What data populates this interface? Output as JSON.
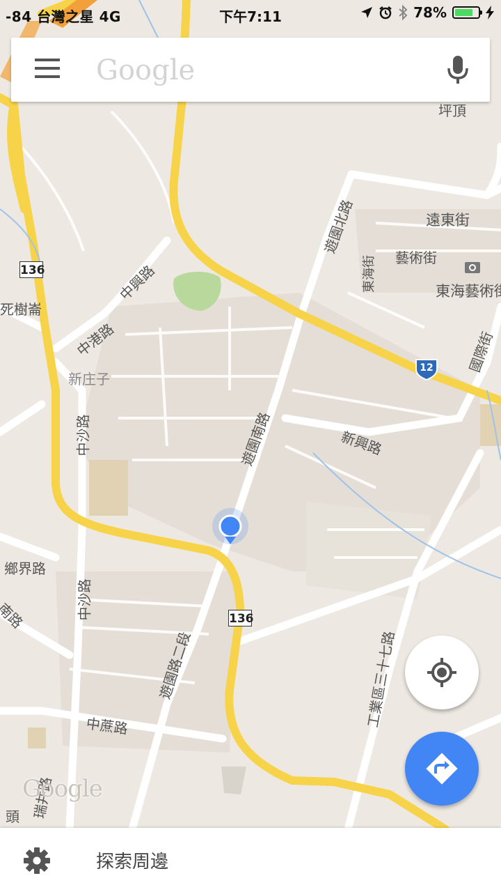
{
  "status": {
    "signal": "-84",
    "carrier": "台灣之星",
    "network": "4G",
    "time": "下午7:11",
    "battery_percent": "78%",
    "battery_level": 0.78,
    "battery_color": "#4cd964"
  },
  "search": {
    "placeholder": "Google",
    "menu_icon": "hamburger-menu-icon",
    "mic_icon": "microphone-icon"
  },
  "map": {
    "labels": {
      "yuanyuan_north": "遊園北路",
      "yuandong": "遠東街",
      "yishu": "藝術街",
      "donghai": "東海街",
      "donghai_art": "東海藝術街",
      "pingding": "坪頂",
      "zhongxing": "中興路",
      "zhonggang": "中港路",
      "sishu": "死樹崙",
      "xinzhuangzi": "新庄子",
      "zhongsha1": "中沙路",
      "zhongsha2": "中沙路",
      "yuanyuan_south": "遊園南路",
      "xinxing": "新興路",
      "guoji": "國際街",
      "xiangjie": "鄉界路",
      "nan": "南路",
      "yuanyuan_2": "遊園路二段",
      "gongye": "工業區三十七路",
      "zhongzhe": "中蔗路",
      "ruijing": "瑞井路",
      "tou": "頭"
    },
    "route_136_a": "136",
    "route_136_b": "136",
    "route_12": "12",
    "watermark": "Google",
    "colors": {
      "background": "#ede9e2",
      "highway": "#f7d34a",
      "road": "#ffffff",
      "park": "#b9d89c",
      "location": "#4285f4"
    }
  },
  "controls": {
    "my_location_icon": "my-location-icon",
    "directions_icon": "directions-icon"
  },
  "bottom": {
    "settings_icon": "gear-icon",
    "explore_label": "探索周邊"
  }
}
